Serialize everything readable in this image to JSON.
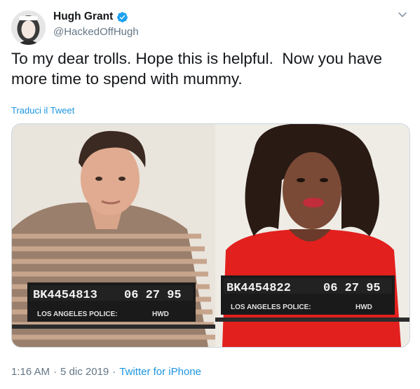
{
  "author": {
    "display_name": "Hugh Grant",
    "handle": "@HackedOffHugh",
    "verified": true
  },
  "icons": {
    "verified": "verified-badge-icon",
    "menu": "chevron-down-icon",
    "avatar": "avatar"
  },
  "tweet": {
    "text": "To my dear trolls. Hope this is helpful.  Now you have more time to spend with mummy.",
    "translate_label": "Traduci il Tweet"
  },
  "media": {
    "left_placard": {
      "number": "BK4454813",
      "date": "06 27 95",
      "department": "LOS ANGELES POLICE:",
      "division": "HWD"
    },
    "right_placard": {
      "number": "BK4454822",
      "date": "06 27 95",
      "department": "LOS ANGELES POLICE:",
      "division": "HWD"
    }
  },
  "meta": {
    "time": "1:16 AM",
    "date": "5 dic 2019",
    "separator": "·",
    "source": "Twitter for iPhone"
  },
  "colors": {
    "link": "#1b95e0",
    "secondary_text": "#657786",
    "verified_blue": "#1da1f2"
  }
}
